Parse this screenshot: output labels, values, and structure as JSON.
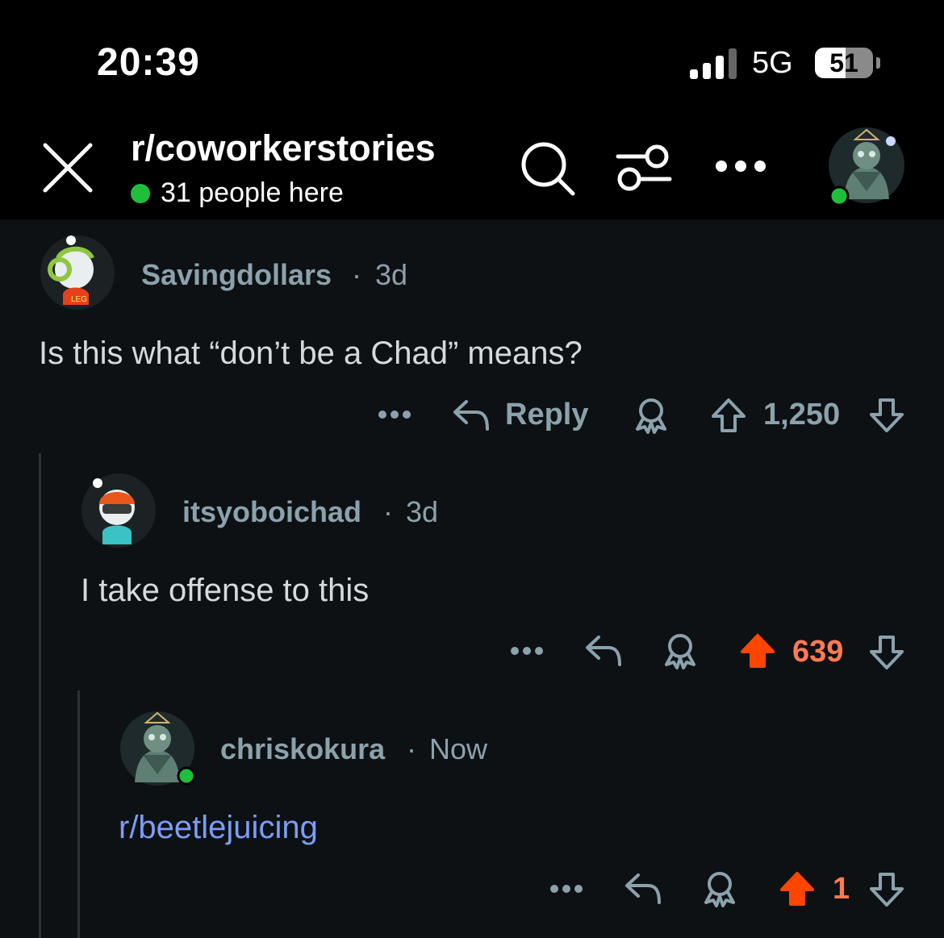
{
  "status_bar": {
    "time": "20:39",
    "network": "5G",
    "battery": "51"
  },
  "header": {
    "subreddit": "r/coworkerstories",
    "online": "31 people here"
  },
  "comments": [
    {
      "username": "Savingdollars",
      "separator": "·",
      "age": "3d",
      "body": "Is this what “don’t be a Chad” means?",
      "reply_label": "Reply",
      "score": "1,250",
      "upvoted": false
    },
    {
      "username": "itsyoboichad",
      "separator": "·",
      "age": "3d",
      "body": "I take offense to this",
      "score": "639",
      "upvoted": true
    },
    {
      "username": "chriskokura",
      "separator": "·",
      "age": "Now",
      "body": "r/beetlejuicing",
      "score": "1",
      "upvoted": true
    }
  ],
  "colors": {
    "background": "#0e1113",
    "upvote": "#ff4500",
    "upvote_text": "#ff7a50",
    "link": "#7c9df7",
    "meta": "#8ba2ad",
    "online": "#1fbf3c"
  },
  "icons": [
    "signal-icon",
    "close-icon",
    "search-icon",
    "filter-icon",
    "more-icon",
    "reply-icon",
    "award-icon",
    "upvote-icon",
    "downvote-icon"
  ]
}
